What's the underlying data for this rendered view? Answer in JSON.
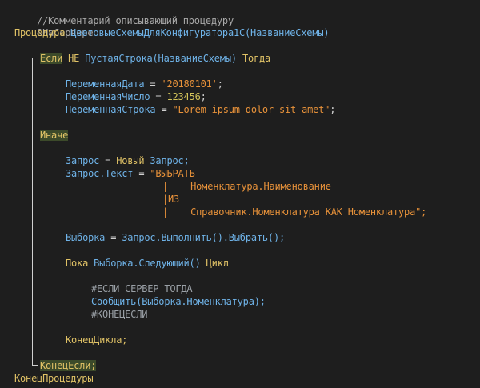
{
  "colors": {
    "background": "#1e1e1e",
    "comment": "#a8a8a8",
    "keyword": "#e0c266",
    "identifier": "#6fb3e8",
    "string": "#e8923a",
    "number": "#d4c45a",
    "keyword_highlight": "#3c4a2a"
  },
  "code": {
    "comment": "//Комментарий описывающий процедуру",
    "directive": "&НаСервере",
    "proc_kw": "Процедура",
    "proc_name": "ЦветовыеСхемыДляКонфигуратора1С",
    "proc_param": "(НазваниеСхемы)",
    "if_kw": "Если",
    "not_kw": "НЕ",
    "func_empty": "ПустаяСтрока",
    "func_arg": "(НазваниеСхемы)",
    "then_kw": "Тогда",
    "var_date": "ПеременнаяДата",
    "eq": "=",
    "date_val": "'20180101'",
    "semicolon": ";",
    "var_num": "ПеременнаяЧисло",
    "num_val": "123456",
    "var_str": "ПеременнаяСтрока",
    "str_val": "\"Lorem ipsum dolor sit amet\"",
    "else_kw": "Иначе",
    "query_var": "Запрос",
    "new_kw": "Новый",
    "query_type": "Запрос;",
    "query_text": "Запрос.Текст",
    "q1": "\"ВЫБРАТЬ",
    "q2": "|    Номенклатура.Наименование",
    "q3": "|ИЗ",
    "q4": "|    Справочник.Номенклатура КАК Номенклатура\";",
    "sel_var": "Выборка",
    "sel_call": "Запрос.Выполнить().Выбрать();",
    "while_kw": "Пока",
    "while_expr": "Выборка.Следующий()",
    "loop_kw": "Цикл",
    "pre_if": "#ЕСЛИ СЕРВЕР ТОГДА",
    "msg_call": "Сообщить(Выборка.Номенклатура);",
    "pre_end": "#КОНЕЦЕСЛИ",
    "end_loop": "КонецЦикла;",
    "end_if": "КонецЕсли;",
    "end_proc": "КонецПроцедуры"
  }
}
